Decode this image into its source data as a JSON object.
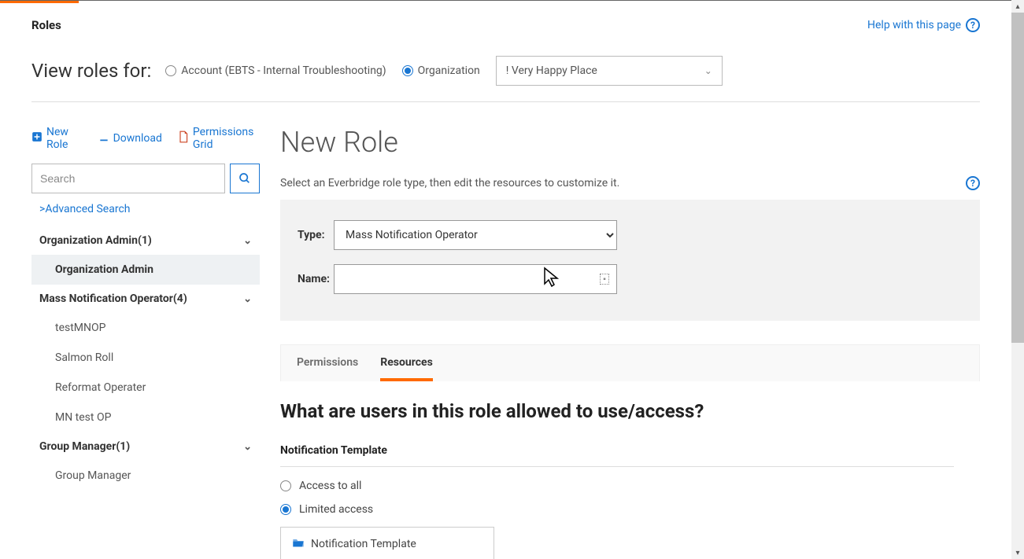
{
  "header": {
    "roles_title": "Roles",
    "help_link": "Help with this page"
  },
  "view_roles": {
    "label": "View roles for:",
    "account_label": "Account (EBTS - Internal Troubleshooting)",
    "org_label": "Organization",
    "selected": "organization",
    "org_select_value": "! Very Happy Place"
  },
  "actions": {
    "new_role": "New Role",
    "download": "Download",
    "permissions_grid": "Permissions Grid"
  },
  "search": {
    "placeholder": "Search",
    "advanced": ">Advanced Search"
  },
  "tree": {
    "g1": {
      "label": "Organization Admin(1)",
      "items": [
        "Organization Admin"
      ]
    },
    "g2": {
      "label": "Mass Notification Operator(4)",
      "items": [
        "testMNOP",
        "Salmon Roll",
        "Reformat Operater",
        "MN test OP"
      ]
    },
    "g3": {
      "label": "Group Manager(1)",
      "items": [
        "Group Manager"
      ]
    }
  },
  "main": {
    "title": "New Role",
    "desc": "Select an Everbridge role type, then edit the resources to customize it.",
    "type_label": "Type:",
    "type_value": "Mass Notification Operator",
    "name_label": "Name:",
    "name_value": ""
  },
  "tabs": {
    "permissions": "Permissions",
    "resources": "Resources",
    "active": "resources"
  },
  "resources": {
    "question": "What are users in this role allowed to use/access?",
    "section_title": "Notification Template",
    "opt_all": "Access to all",
    "opt_limited": "Limited access",
    "selected": "limited",
    "template_item": "Notification Template"
  }
}
